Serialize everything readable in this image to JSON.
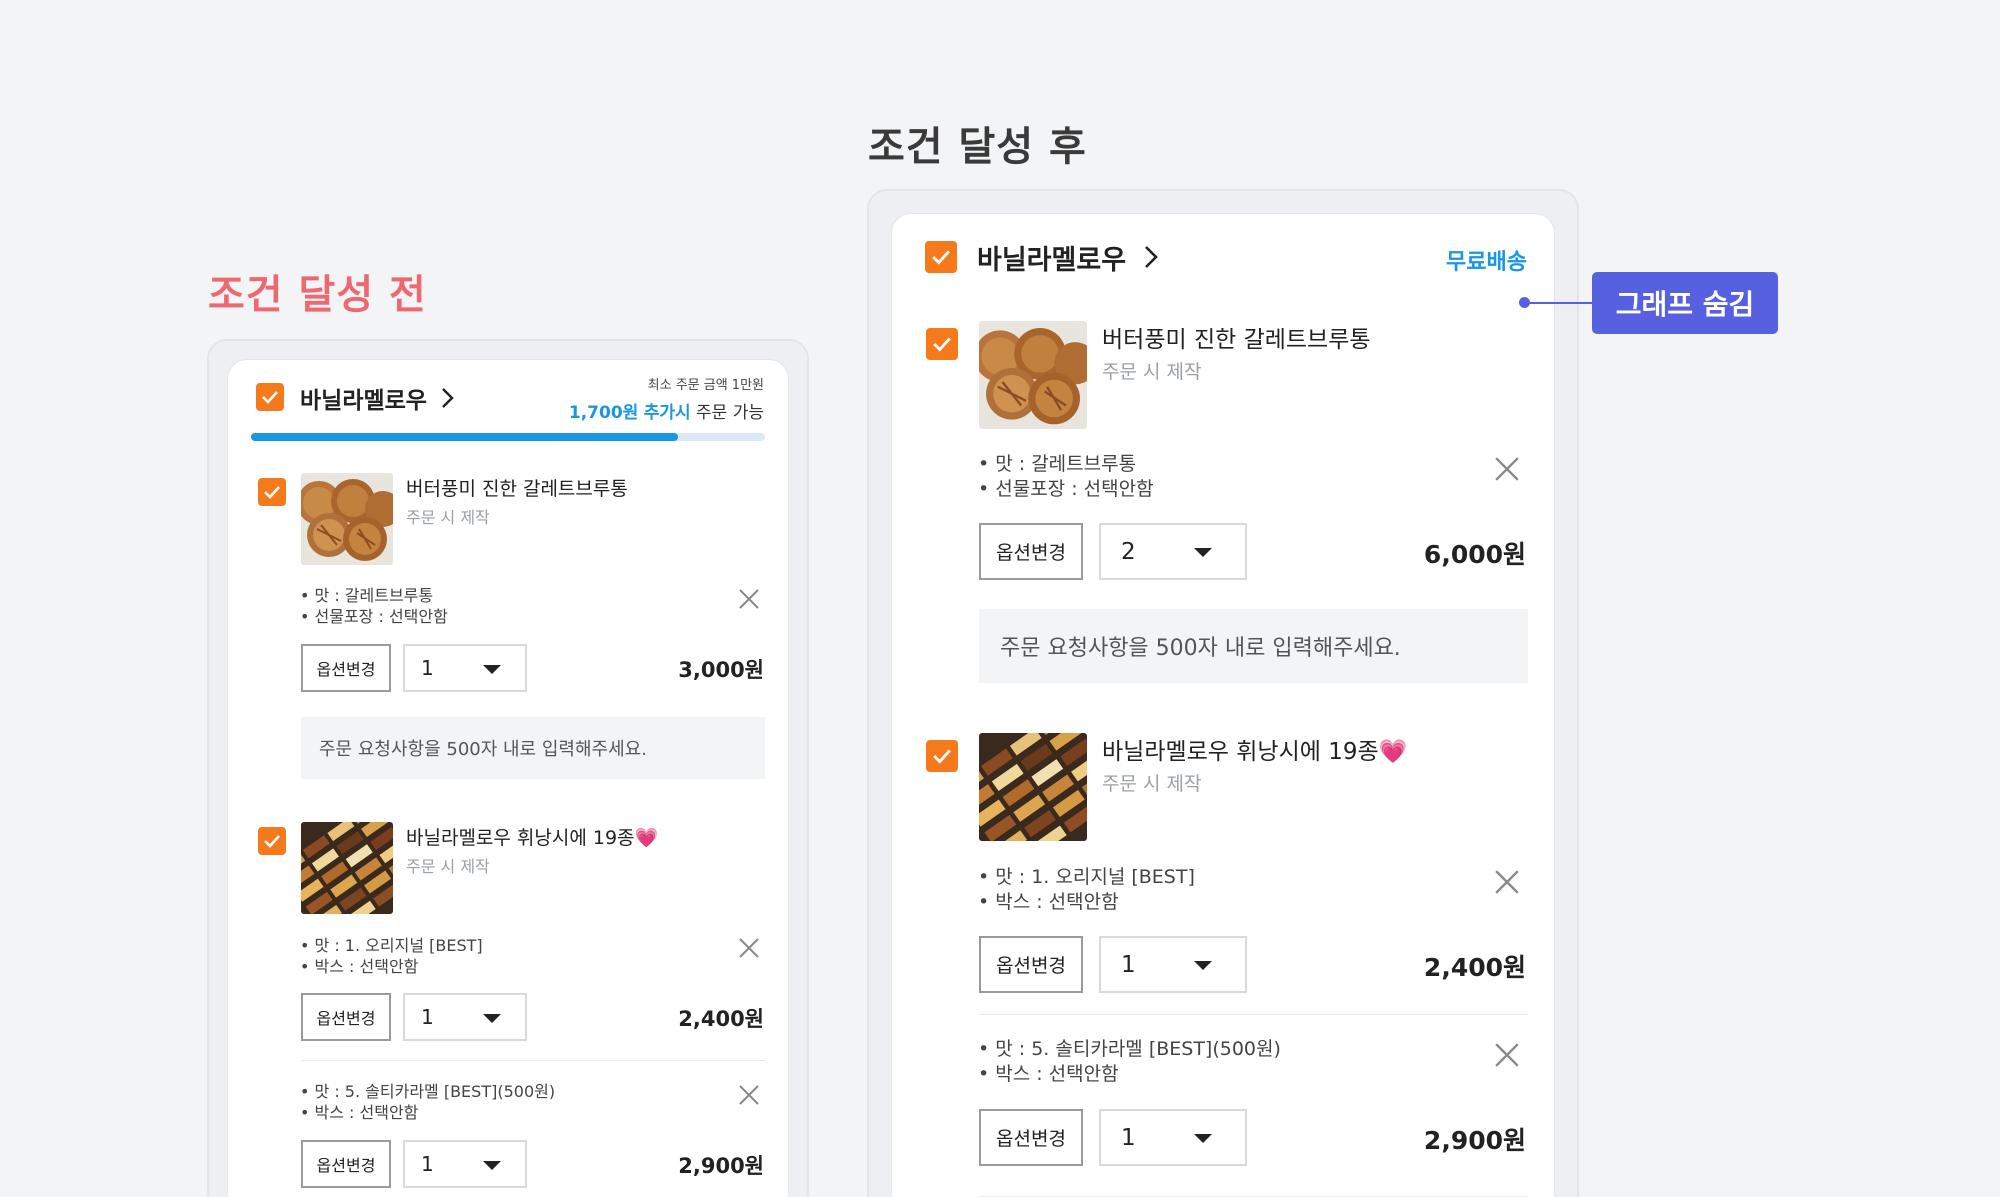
{
  "headings": {
    "before": "조건 달성 전",
    "after": "조건 달성 후"
  },
  "annotation": {
    "label": "그래프 숨김"
  },
  "colors": {
    "checkbox": "#f57a1c",
    "accent_blue": "#1a96e6",
    "progress_fill": "#1a96e6",
    "heading_before": "#ee6872",
    "badge": "#5660e0"
  },
  "before": {
    "store": {
      "name": "바닐라멜로우",
      "min_order_note": "최소 주문 금액 1만원",
      "add_amount": "1,700원",
      "add_suffix": "추가시",
      "order_possible": "주문 가능",
      "progress": 0.83
    },
    "products": [
      {
        "name": "버터풍미 진한 갈레트브루통",
        "sub": "주문 시 제작",
        "options": [
          {
            "lines": [
              "• 맛 : 갈레트브루통",
              "• 선물포장 : 선택안함"
            ],
            "change_label": "옵션변경",
            "qty": "1",
            "price": "3,000원"
          }
        ],
        "memo_placeholder": "주문 요청사항을 500자 내로 입력해주세요."
      },
      {
        "name": "바닐라멜로우 휘낭시에 19종💗",
        "sub": "주문 시 제작",
        "options": [
          {
            "lines": [
              "• 맛 : 1. 오리지널 [BEST]",
              "• 박스 : 선택안함"
            ],
            "change_label": "옵션변경",
            "qty": "1",
            "price": "2,400원"
          },
          {
            "lines": [
              "• 맛 : 5. 솔티카라멜 [BEST](500원)",
              "• 박스 : 선택안함"
            ],
            "change_label": "옵션변경",
            "qty": "1",
            "price": "2,900원"
          }
        ]
      }
    ]
  },
  "after": {
    "store": {
      "name": "바닐라멜로우",
      "free_shipping": "무료배송"
    },
    "products": [
      {
        "name": "버터풍미 진한 갈레트브루통",
        "sub": "주문 시 제작",
        "options": [
          {
            "lines": [
              "• 맛 : 갈레트브루통",
              "• 선물포장 : 선택안함"
            ],
            "change_label": "옵션변경",
            "qty": "2",
            "price": "6,000원"
          }
        ],
        "memo_placeholder": "주문 요청사항을 500자 내로 입력해주세요."
      },
      {
        "name": "바닐라멜로우 휘낭시에 19종💗",
        "sub": "주문 시 제작",
        "options": [
          {
            "lines": [
              "• 맛 : 1. 오리지널 [BEST]",
              "• 박스 : 선택안함"
            ],
            "change_label": "옵션변경",
            "qty": "1",
            "price": "2,400원"
          },
          {
            "lines": [
              "• 맛 : 5. 솔티카라멜 [BEST](500원)",
              "• 박스 : 선택안함"
            ],
            "change_label": "옵션변경",
            "qty": "1",
            "price": "2,900원"
          }
        ]
      }
    ]
  }
}
